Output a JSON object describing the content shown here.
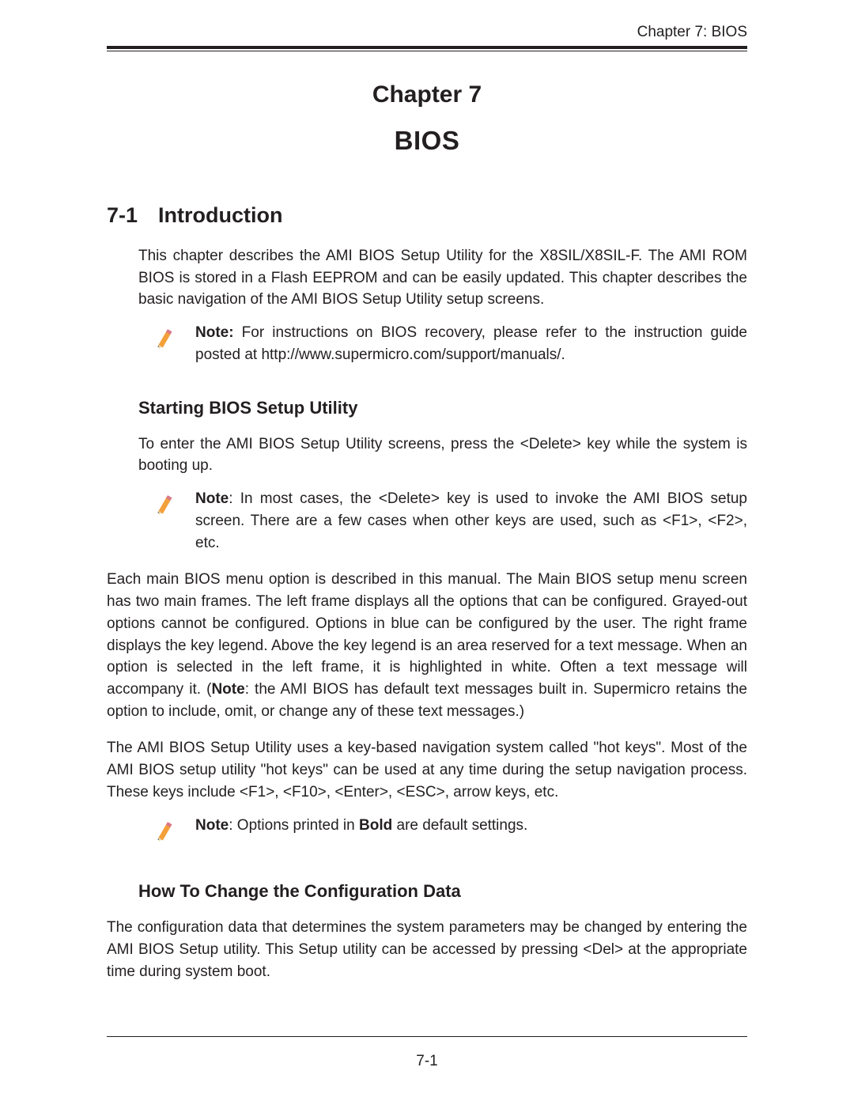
{
  "header": {
    "running_head": "Chapter 7: BIOS"
  },
  "chapter": {
    "label": "Chapter 7",
    "title": "BIOS"
  },
  "section1": {
    "number": "7-1",
    "title": "Introduction",
    "intro_para": "This chapter describes the AMI BIOS Setup Utility for the X8SIL/X8SIL-F. The AMI ROM BIOS is stored in a Flash EEPROM and can be easily updated. This chapter describes the basic navigation of the AMI BIOS Setup Utility setup screens.",
    "note1_label": "Note:",
    "note1_text": " For instructions on BIOS recovery, please refer to the instruction guide posted at http://www.supermicro.com/support/manuals/."
  },
  "sub1": {
    "heading": "Starting BIOS Setup Utility",
    "para1": "To enter the AMI BIOS Setup Utility screens, press the <Delete> key while the system is booting up.",
    "note_label": "Note",
    "note_text": ": In most cases, the <Delete> key is used to invoke the AMI BIOS setup screen. There are a few cases when other keys are used, such as <F1>, <F2>, etc.",
    "para2_a": "Each main BIOS menu option is described in this manual. The Main BIOS setup menu screen has two main frames. The left frame displays all the options that can be configured. Grayed-out options cannot be configured. Options in blue can be configured by the user. The right frame displays the key legend. Above the key legend is an area reserved for a text message. When an option is selected in the left frame, it is highlighted in white. Often a text message will accompany it. (",
    "para2_note_word": "Note",
    "para2_b": ": the AMI BIOS has default text messages built in. Supermicro retains the option to include, omit, or change any of these text messages.)",
    "para3": "The AMI BIOS Setup Utility uses a key-based navigation system called \"hot keys\". Most of the AMI BIOS setup utility \"hot keys\" can be used at any time during the setup navigation process. These keys include <F1>, <F10>, <Enter>, <ESC>, arrow keys, etc.",
    "note3_label": "Note",
    "note3_a": ": Options printed in ",
    "note3_bold": "Bold",
    "note3_b": " are default settings."
  },
  "sub2": {
    "heading": "How To Change the Configuration Data",
    "para": "The configuration data that determines the system parameters may be changed by entering the  AMI BIOS Setup utility. This Setup utility can be accessed by pressing <Del> at the appropriate time during system boot."
  },
  "footer": {
    "page_number": "7-1"
  }
}
